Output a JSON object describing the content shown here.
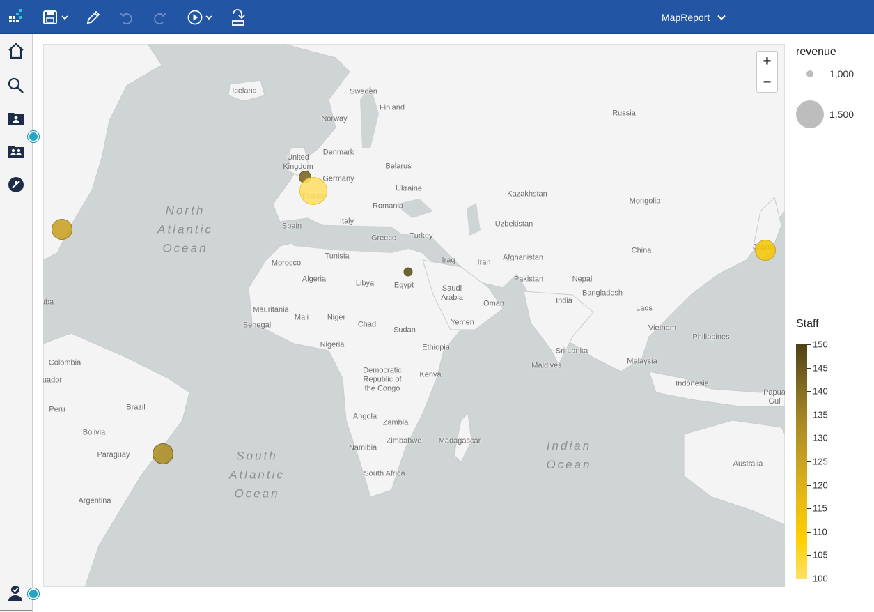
{
  "header": {
    "report_title": "MapReport",
    "icons": [
      "app-grid-icon",
      "save-icon",
      "edit-pencil-icon",
      "undo-icon",
      "redo-icon",
      "run-play-icon",
      "share-export-icon"
    ],
    "accent_color": "#2255a4"
  },
  "sidebar": {
    "items": [
      "home-icon",
      "search-icon",
      "my-content-folder-icon",
      "team-content-folder-icon",
      "recent-icon",
      "user-account-icon"
    ]
  },
  "map": {
    "countries": [
      {
        "name": "Iceland"
      },
      {
        "name": "Sweden"
      },
      {
        "name": "Finland"
      },
      {
        "name": "Norway"
      },
      {
        "name": "Russia"
      },
      {
        "name": "Denmark"
      },
      {
        "name": "United\nKingdom"
      },
      {
        "name": "Belarus"
      },
      {
        "name": "Germany"
      },
      {
        "name": "Ukraine"
      },
      {
        "name": "France"
      },
      {
        "name": "Romania"
      },
      {
        "name": "Kazakhstan"
      },
      {
        "name": "Mongolia"
      },
      {
        "name": "Spain"
      },
      {
        "name": "Italy"
      },
      {
        "name": "Uzbekistan"
      },
      {
        "name": "Greece"
      },
      {
        "name": "Turkey"
      },
      {
        "name": "China"
      },
      {
        "name": "Japan"
      },
      {
        "name": "Morocco"
      },
      {
        "name": "Tunisia"
      },
      {
        "name": "Iraq"
      },
      {
        "name": "Iran"
      },
      {
        "name": "Afghanistan"
      },
      {
        "name": "Algeria"
      },
      {
        "name": "Libya"
      },
      {
        "name": "Egypt"
      },
      {
        "name": "Saudi\nArabia"
      },
      {
        "name": "Pakistan"
      },
      {
        "name": "Nepal"
      },
      {
        "name": "Bangladesh"
      },
      {
        "name": "India"
      },
      {
        "name": "Oman"
      },
      {
        "name": "Mauritania"
      },
      {
        "name": "Mali"
      },
      {
        "name": "Niger"
      },
      {
        "name": "Chad"
      },
      {
        "name": "Sudan"
      },
      {
        "name": "Yemen"
      },
      {
        "name": "Laos"
      },
      {
        "name": "Senegal"
      },
      {
        "name": "Vietnam"
      },
      {
        "name": "Philippines"
      },
      {
        "name": "Nigeria"
      },
      {
        "name": "Ethiopia"
      },
      {
        "name": "Sri Lanka"
      },
      {
        "name": "Maldives"
      },
      {
        "name": "Malaysia"
      },
      {
        "name": "Colombia"
      },
      {
        "name": "uador"
      },
      {
        "name": "Democratic\nRepublic of\nthe Congo"
      },
      {
        "name": "Kenya"
      },
      {
        "name": "Indonesia"
      },
      {
        "name": "Papua\nGui"
      },
      {
        "name": "Peru"
      },
      {
        "name": "Brazil"
      },
      {
        "name": "Bolivia"
      },
      {
        "name": "Angola"
      },
      {
        "name": "Zambia"
      },
      {
        "name": "Zimbabwe"
      },
      {
        "name": "Madagascar"
      },
      {
        "name": "Paraguay"
      },
      {
        "name": "Namibia"
      },
      {
        "name": "South Africa"
      },
      {
        "name": "Australia"
      },
      {
        "name": "Argentina"
      },
      {
        "name": "uba"
      }
    ],
    "oceans": [
      {
        "name": "North\nAtlantic\nOcean"
      },
      {
        "name": "South\nAtlantic\nOcean"
      },
      {
        "name": "Indian\nOcean"
      }
    ],
    "bubbles": [
      {
        "location": "United Kingdom",
        "staff": 142
      },
      {
        "location": "France",
        "staff": 100
      },
      {
        "location": "United States East Coast",
        "staff": 125
      },
      {
        "location": "Egypt",
        "staff": 147
      },
      {
        "location": "Japan",
        "staff": 112
      },
      {
        "location": "Brazil",
        "staff": 132
      }
    ],
    "zoom": {
      "in": "+",
      "out": "−"
    }
  },
  "legend": {
    "size_title": "revenue",
    "size_entries": [
      {
        "label": "1,000",
        "value": 1000
      },
      {
        "label": "1,500",
        "value": 1500
      }
    ],
    "color_title": "Staff",
    "color_ticks": [
      "150",
      "145",
      "140",
      "135",
      "130",
      "125",
      "120",
      "115",
      "110",
      "105",
      "100"
    ],
    "color_min": 100,
    "color_max": 150,
    "gradient": [
      "#ffe066",
      "#ffd000",
      "#e8bb12",
      "#c9a222",
      "#a88a25",
      "#7d6820",
      "#4f4116"
    ]
  }
}
